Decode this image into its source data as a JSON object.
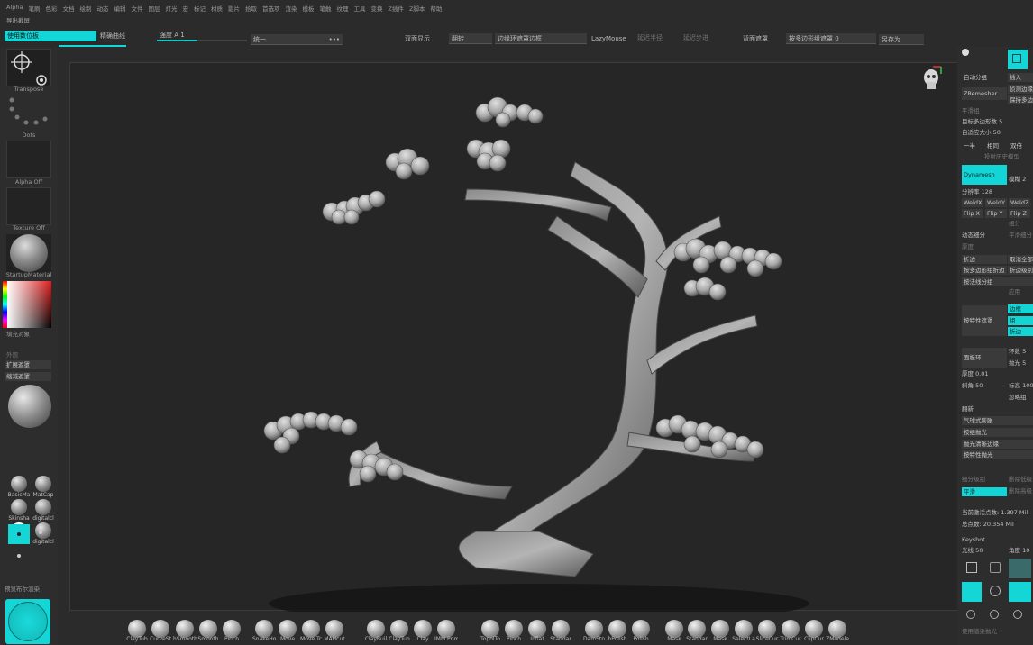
{
  "menu": [
    "Alpha",
    "笔刷",
    "色彩",
    "文档",
    "绘制",
    "动态",
    "编辑",
    "文件",
    "图层",
    "灯光",
    "宏",
    "标记",
    "材质",
    "影片",
    "拾取",
    "首选项",
    "渲染",
    "模板",
    "笔触",
    "纹理",
    "工具",
    "变换",
    "Z插件",
    "Z脚本",
    "帮助"
  ],
  "subbar": "导出截屏",
  "toolbar": {
    "use_selection": "使用数位板",
    "precise_curve": "精确曲线",
    "strength": "强度 A 1",
    "unify": "统一",
    "dots": "•••",
    "double_side": "双面显示",
    "flip": "翻转",
    "edge_loop_mask": "边缘环遮罩边框",
    "lazymouse": "LazyMouse",
    "lazy_step": "延迟半径",
    "lazy_smooth": "延迟步进",
    "backface": "背面遮罩",
    "group_polygroup": "按多边形组遮罩 0",
    "save_as": "另存为"
  },
  "left": {
    "transpose": "Transpose",
    "dots": "Dots",
    "alpha": "Alpha Off",
    "texture": "Texture Off",
    "material": "StartupMaterial",
    "fill": "填充对象",
    "outer": "外观",
    "expand_mask": "扩展遮罩",
    "shrink_mask": "缩减遮罩",
    "mats": [
      "BasicMa",
      "MatCap",
      "Skinsha",
      "digitalcl",
      "FlatColc",
      "digitalcl",
      "BumpVe",
      "Blinn"
    ],
    "preview": "预览布尔渲染"
  },
  "right": {
    "auto_group": "自动分组",
    "insert": "插入",
    "zremesher": "ZRemesher",
    "detect_edge": "侦测边缘",
    "keep_groups": "保持多边",
    "smooth_grp": "平滑组",
    "target_poly": "目标多边形数 5",
    "adaptive": "自适应大小 50",
    "half": "一半",
    "same": "相同",
    "double": "双倍",
    "project_hist": "投射历史模型",
    "dynamesh": "Dynamesh",
    "mode": "模糊 2",
    "resolution": "分辨率 128",
    "weld": [
      "WeldX",
      "WeldY",
      "WeldZ"
    ],
    "flip": [
      "Flip X",
      "Flip Y",
      "Flip Z"
    ],
    "group": "组分",
    "dyn_subdiv": "动态细分",
    "smooth_subdiv": "平滑细分",
    "thickness": "厚度",
    "crease": "折边",
    "uncrease_all": "取消全部",
    "crease_by_group": "按多边形组折边",
    "crease_level": "折边级别",
    "by_normal_group": "按法线分组",
    "apply": "应用",
    "by_feature_mask": "按特性遮罩",
    "mask_opts": [
      "边框",
      "组",
      "折边"
    ],
    "panel_loop": "面板环",
    "loops": "环数 5",
    "polish": "抛光 5",
    "thickness2": "厚度 0.01",
    "bevel": "斜角 50",
    "elevation": "标高 100",
    "ignore": "忽略组",
    "mask_by": "翻新",
    "bulge": "气球式膨胀",
    "polish_group": "按组抛光",
    "polish_sharp": "抛光清晰边缘",
    "polish_feature": "按特性抛光",
    "unrestrict": "细分级别",
    "delete_lower": "删除低级",
    "smooth": "平滑",
    "delete_higher": "删除高级",
    "active_points": "当前激活点数: 1.397 Mil",
    "total_points": "总点数: 20.354 Mil",
    "keyshot": "Keyshot",
    "light": "光线 50",
    "angle": "角度 10",
    "use_polish": "使用渲染抛光"
  },
  "bottom": {
    "brushes": [
      "ClayTub",
      "CurveSt",
      "hSmooth",
      "Smooth",
      "Pinch",
      "SnakeHo",
      "Move",
      "Move Tc",
      "MAHcut",
      "ClayBuil",
      "ClayTub",
      "Clay",
      "IMM Prim",
      "TopolTo",
      "Pinch",
      "Inflat",
      "Standar",
      "DamStn",
      "hPolish",
      "Polish",
      "Mask",
      "Standar",
      "Mask",
      "SelectLa",
      "SliceCur",
      "TrimCur",
      "ClipCur",
      "ZModele"
    ],
    "zadd": "Zadd",
    "zsub": "Zsub",
    "labels1": "渐变",
    "labels2": "RGB强度",
    "labels3": "绘制标签"
  },
  "colors": {
    "cyan": "#15d6d6",
    "bg": "#2b2b2b",
    "viewport": "#262626"
  }
}
